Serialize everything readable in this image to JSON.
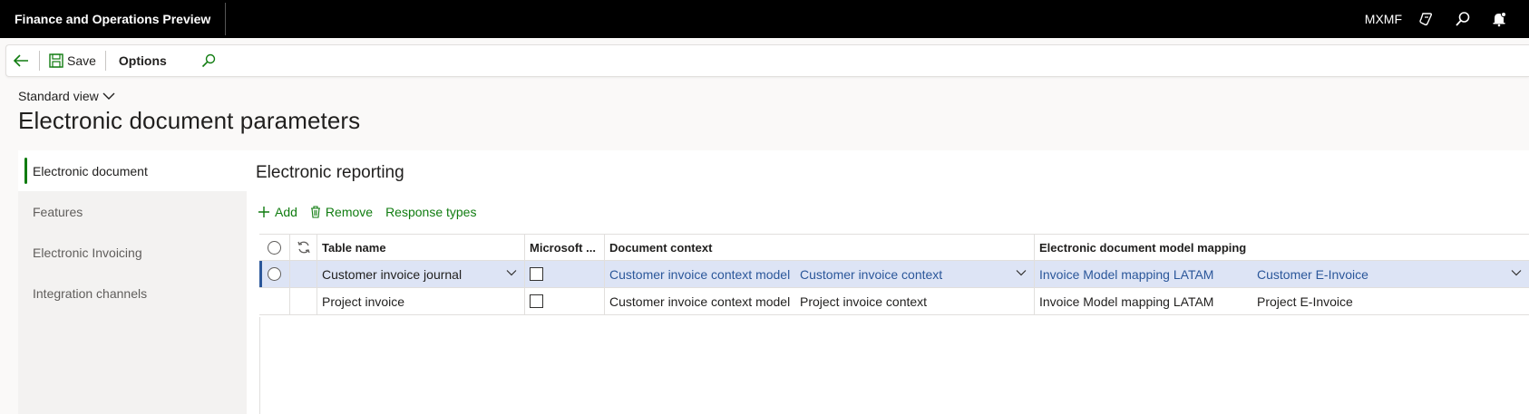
{
  "app": {
    "title": "Finance and Operations Preview",
    "company": "MXMF"
  },
  "topbar": {
    "icons": [
      "copilot-icon",
      "search-icon",
      "notification-icon"
    ]
  },
  "actionbar": {
    "back": "back-icon",
    "save_label": "Save",
    "options_label": "Options",
    "search": "search-icon"
  },
  "page": {
    "view_label": "Standard view",
    "title": "Electronic document parameters"
  },
  "nav": {
    "items": [
      {
        "label": "Electronic document",
        "active": true
      },
      {
        "label": "Features",
        "active": false
      },
      {
        "label": "Electronic Invoicing",
        "active": false
      },
      {
        "label": "Integration channels",
        "active": false
      }
    ]
  },
  "section": {
    "title": "Electronic reporting",
    "actions": {
      "add": "Add",
      "remove": "Remove",
      "response_types": "Response types"
    }
  },
  "grid": {
    "headers": {
      "table_name": "Table name",
      "microsoft": "Microsoft ...",
      "doc_context": "Document context",
      "model_mapping": "Electronic document model mapping"
    },
    "rows": [
      {
        "table_name": "Customer invoice journal",
        "microsoft": false,
        "context_model": "Customer invoice context model",
        "context": "Customer invoice context",
        "mapping": "Invoice Model mapping LATAM",
        "mapping_def": "Customer E-Invoice",
        "selected": true
      },
      {
        "table_name": "Project invoice",
        "microsoft": false,
        "context_model": "Customer invoice context model",
        "context": "Project invoice context",
        "mapping": "Invoice Model mapping LATAM",
        "mapping_def": "Project E-Invoice",
        "selected": false
      }
    ]
  },
  "colors": {
    "accent_green": "#107c10",
    "link_blue": "#2b579a",
    "selected_row": "#dde4f5"
  }
}
